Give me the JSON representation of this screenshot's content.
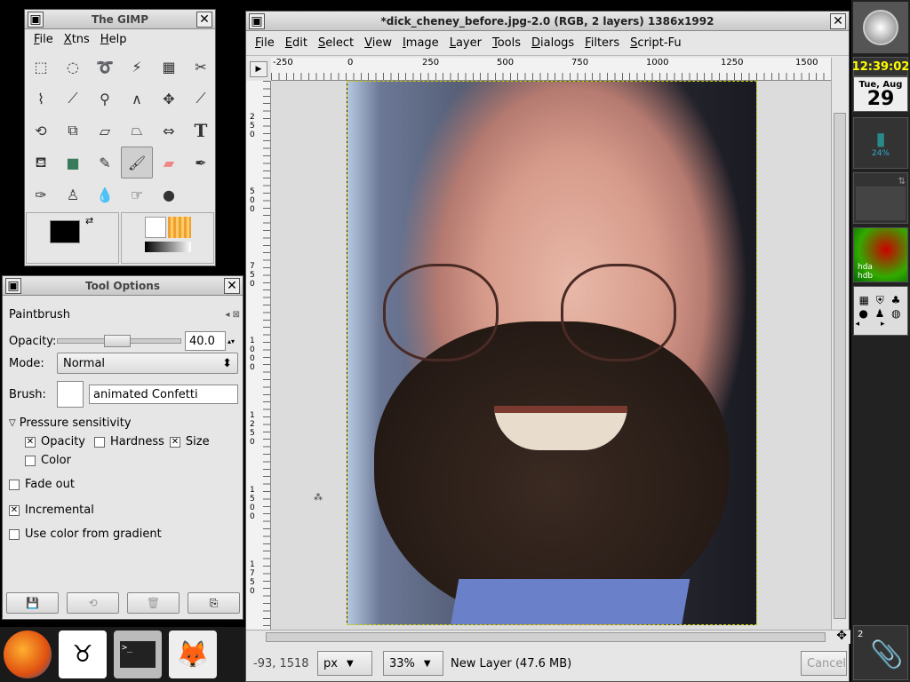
{
  "toolbox": {
    "title": "The GIMP",
    "menu": [
      "File",
      "Xtns",
      "Help"
    ]
  },
  "tool_options": {
    "title": "Tool Options",
    "tool_name": "Paintbrush",
    "opacity_label": "Opacity:",
    "opacity_value": "40.0",
    "opacity_fraction": 0.4,
    "mode_label": "Mode:",
    "mode_value": "Normal",
    "brush_label": "Brush:",
    "brush_value": "animated Confetti",
    "pressure_label": "Pressure sensitivity",
    "opt_opacity": "Opacity",
    "opt_hardness": "Hardness",
    "opt_size": "Size",
    "opt_color": "Color",
    "fade_out": "Fade out",
    "incremental": "Incremental",
    "use_gradient": "Use color from gradient"
  },
  "image_window": {
    "title": "*dick_cheney_before.jpg-2.0 (RGB, 2 layers) 1386x1992",
    "menu": [
      "File",
      "Edit",
      "Select",
      "View",
      "Image",
      "Layer",
      "Tools",
      "Dialogs",
      "Filters",
      "Script-Fu"
    ],
    "ruler_h": [
      "-250",
      "0",
      "250",
      "500",
      "750",
      "1000",
      "1250",
      "1500"
    ],
    "ruler_v": [
      "2 5 0",
      "5 0 0",
      "7 5 0",
      "1 0 0 0",
      "1 2 5 0",
      "1 5 0 0",
      "1 7 5 0"
    ],
    "coords": "-93, 1518",
    "unit": "px",
    "zoom": "33%",
    "layer_info": "New Layer (47.6 MB)",
    "cancel": "Cancel"
  },
  "dock": {
    "clock": "12:39:02",
    "date_day": "Tue, Aug",
    "date_num": "29",
    "battery": "24%",
    "disks": "hda\nhdb",
    "workspace": "2"
  }
}
